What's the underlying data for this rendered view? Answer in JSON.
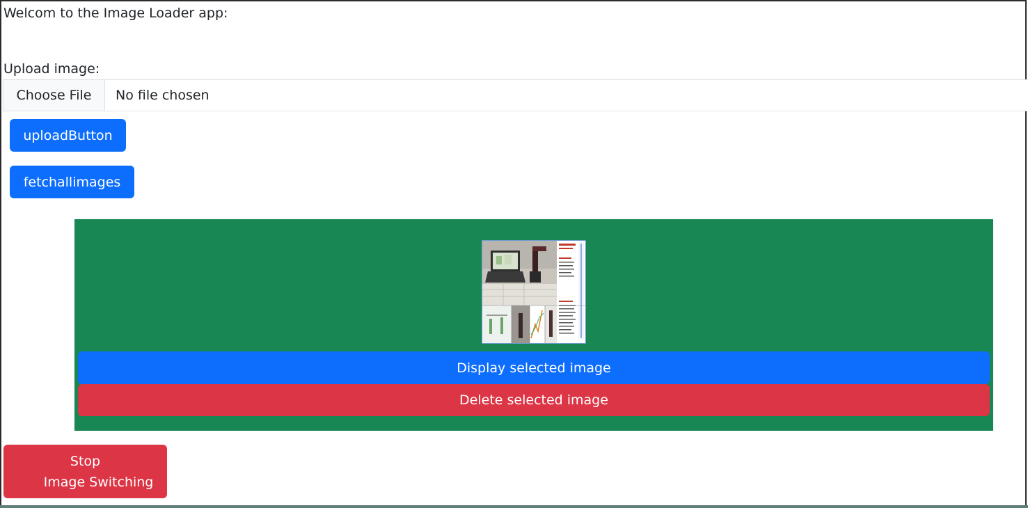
{
  "header": {
    "welcome_text": "Welcom to the Image Loader app:"
  },
  "upload": {
    "label": "Upload image:",
    "choose_file_label": "Choose File",
    "file_status": "No file chosen",
    "upload_button_label": "uploadButton",
    "fetch_button_label": "fetchallimages"
  },
  "gallery": {
    "background_color": "#198754",
    "display_button_label": "Display selected image",
    "delete_button_label": "Delete selected image"
  },
  "controls": {
    "stop_line1": "Stop",
    "stop_line2": "Image Switching"
  },
  "colors": {
    "primary": "#0d6efd",
    "danger": "#dc3545",
    "success": "#198754"
  }
}
